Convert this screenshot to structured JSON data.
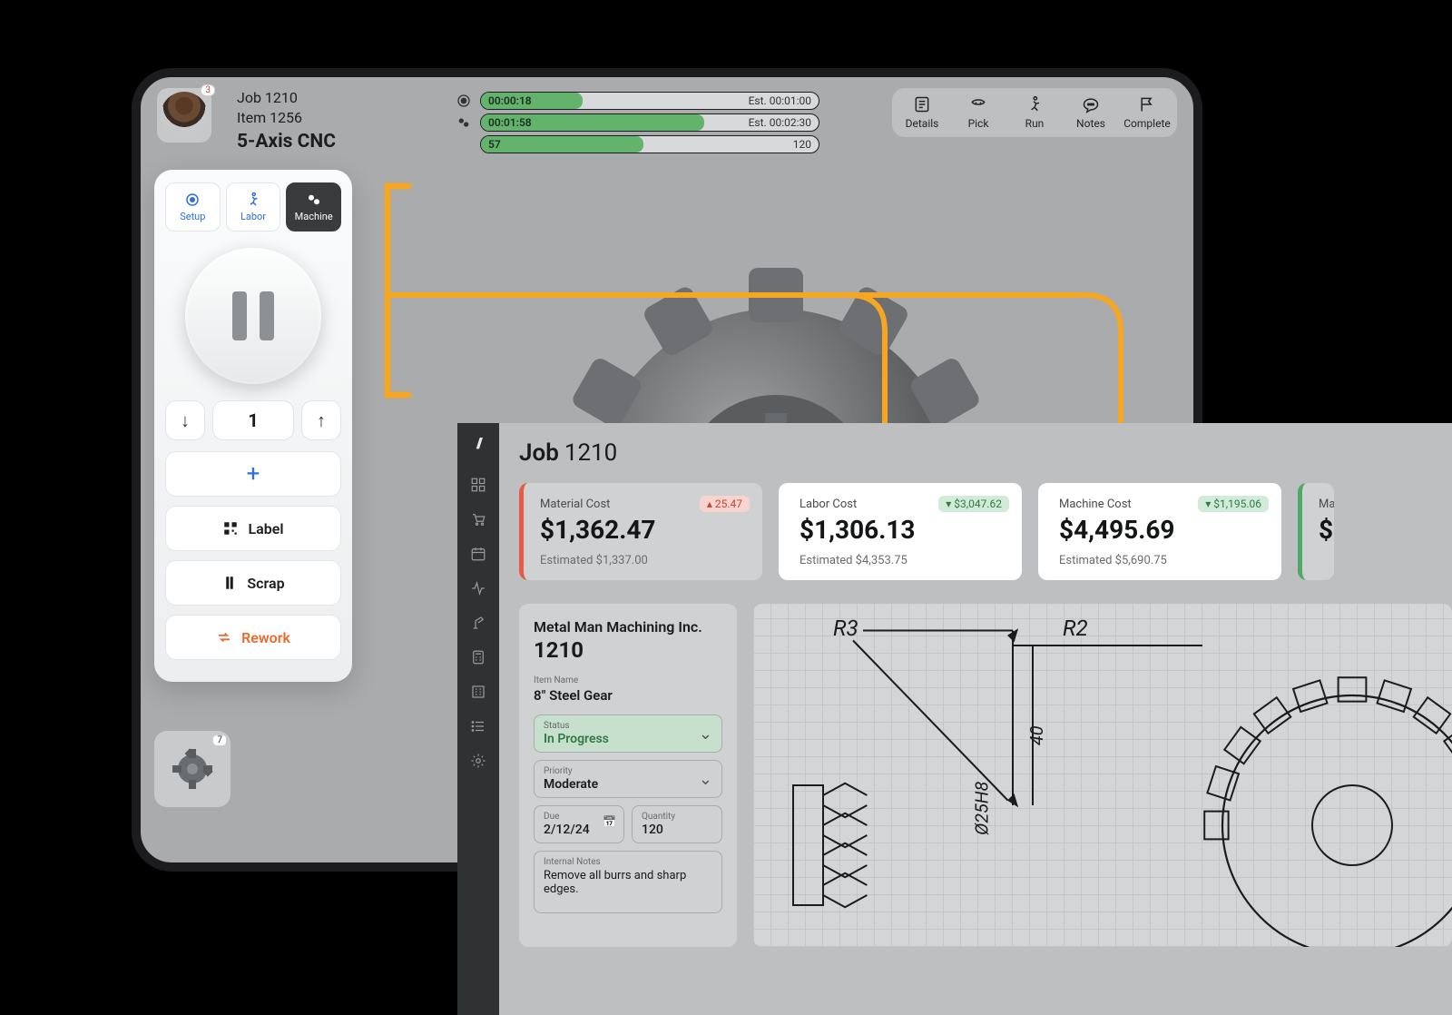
{
  "header": {
    "badge": "3",
    "job_line": "Job 1210",
    "item_line": "Item 1256",
    "machine": "5-Axis CNC"
  },
  "timers": [
    {
      "icon": "target",
      "elapsed": "00:00:18",
      "est_label": "Est.",
      "est": "00:01:00",
      "fill": 30
    },
    {
      "icon": "gears",
      "elapsed": "00:01:58",
      "est_label": "Est.",
      "est": "00:02:30",
      "fill": 66
    },
    {
      "icon": "",
      "elapsed": "57",
      "est_label": "",
      "est": "120",
      "fill": 48
    }
  ],
  "actions": [
    {
      "key": "details",
      "label": "Details"
    },
    {
      "key": "pick",
      "label": "Pick"
    },
    {
      "key": "run",
      "label": "Run"
    },
    {
      "key": "notes",
      "label": "Notes"
    },
    {
      "key": "complete",
      "label": "Complete"
    }
  ],
  "panel": {
    "tabs": [
      {
        "key": "setup",
        "label": "Setup"
      },
      {
        "key": "labor",
        "label": "Labor"
      },
      {
        "key": "machine",
        "label": "Machine"
      }
    ],
    "qty": "1",
    "add": "+",
    "label_btn": "Label",
    "scrap_btn": "Scrap",
    "rework_btn": "Rework"
  },
  "thumb_badge": "7",
  "job_detail": {
    "title_prefix": "Job",
    "title_num": "1210",
    "cards": [
      {
        "title": "Material Cost",
        "value": "$1,362.47",
        "est": "Estimated $1,337.00",
        "chip": "25.47",
        "chip_dir": "up",
        "accent": "red",
        "bg": "tint"
      },
      {
        "title": "Labor Cost",
        "value": "$1,306.13",
        "est": "Estimated $4,353.75",
        "chip": "$3,047.62",
        "chip_dir": "down",
        "accent": "",
        "bg": "white"
      },
      {
        "title": "Machine Cost",
        "value": "$4,495.69",
        "est": "Estimated $5,690.75",
        "chip": "$1,195.06",
        "chip_dir": "down",
        "accent": "",
        "bg": "white"
      },
      {
        "title": "Ma",
        "value": "$",
        "est": "",
        "chip": "",
        "chip_dir": "",
        "accent": "green",
        "bg": "tint"
      }
    ],
    "company": "Metal Man Machining Inc.",
    "jnum": "1210",
    "item_name_label": "Item Name",
    "item_name": "8\" Steel Gear",
    "status_label": "Status",
    "status": "In Progress",
    "priority_label": "Priority",
    "priority": "Moderate",
    "due_label": "Due",
    "due": "2/12/24",
    "qty_label": "Quantity",
    "qty": "120",
    "notes_label": "Internal Notes",
    "notes": "Remove all burrs and sharp edges."
  },
  "blueprint": {
    "r3": "R3",
    "r2": "R2",
    "dim1": "40",
    "dim2": "Ø25H8"
  }
}
